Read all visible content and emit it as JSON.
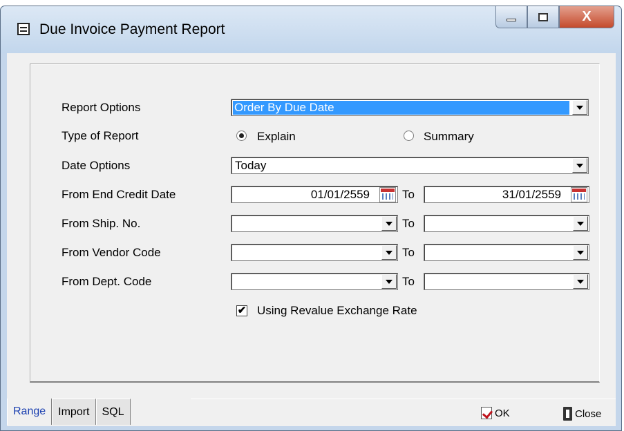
{
  "window": {
    "title": "Due Invoice Payment Report",
    "controls": {
      "minimize": "minimize",
      "maximize": "maximize",
      "close": "X"
    }
  },
  "form": {
    "report_options": {
      "label": "Report Options",
      "value": "Order By Due Date"
    },
    "type_of_report": {
      "label": "Type of Report",
      "options": [
        {
          "label": "Explain",
          "selected": true
        },
        {
          "label": "Summary",
          "selected": false
        }
      ]
    },
    "date_options": {
      "label": "Date Options",
      "value": "Today"
    },
    "end_credit_date": {
      "label": "From End Credit Date",
      "from": "01/01/2559",
      "to_label": "To",
      "to": "31/01/2559"
    },
    "ship_no": {
      "label": "From Ship. No.",
      "from": "",
      "to_label": "To",
      "to": ""
    },
    "vendor_code": {
      "label": "From Vendor Code",
      "from": "",
      "to_label": "To",
      "to": ""
    },
    "dept_code": {
      "label": "From Dept. Code",
      "from": "",
      "to_label": "To",
      "to": ""
    },
    "revalue": {
      "label": "Using Revalue Exchange Rate",
      "checked": true,
      "mark": "✔"
    }
  },
  "tabs": [
    {
      "label": "Range",
      "active": true
    },
    {
      "label": "Import",
      "active": false
    },
    {
      "label": "SQL",
      "active": false
    }
  ],
  "buttons": {
    "ok": "OK",
    "close": "Close"
  },
  "colors": {
    "selection": "#3399ff",
    "active_tab_text": "#1a3fb0",
    "title_bar": "#c4d6eb"
  }
}
